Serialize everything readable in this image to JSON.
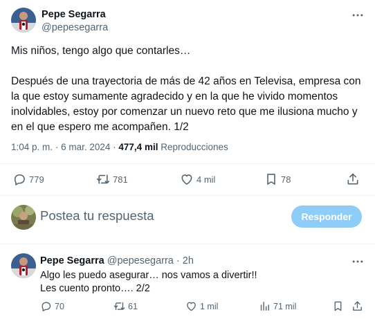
{
  "main_tweet": {
    "author_name": "Pepe Segarra",
    "author_handle": "@pepesegarra",
    "paragraphs": [
      "Mis niños, tengo algo que contarles…",
      "Después de una trayectoria de más de 42 años en Televisa, empresa con la que estoy sumamente agradecido y en la que he vivido momentos inolvidables, estoy por comenzar un nuevo reto que me ilusiona mucho y en el que espero me acompañen. 1/2"
    ],
    "time": "1:04 p. m.",
    "separator": "·",
    "date": "6 mar. 2024",
    "views_count": "477,4 mil",
    "views_label": "Reproducciones",
    "replies": "779",
    "reposts": "781",
    "likes": "4 mil",
    "bookmarks": "78"
  },
  "reply_box": {
    "placeholder": "Postea tu respuesta",
    "button_label": "Responder"
  },
  "reply_tweet": {
    "author_name": "Pepe Segarra",
    "author_handle": "@pepesegarra",
    "separator": "·",
    "time_ago": "2h",
    "lines": [
      "Algo les puedo asegurar… nos vamos a divertir!!",
      "Les cuento pronto…. 2/2"
    ],
    "replies": "70",
    "reposts": "61",
    "likes": "1 mil",
    "views": "71 mil"
  },
  "colors": {
    "text": "#0f1419",
    "secondary": "#536471",
    "divider": "#eff3f4",
    "reply_button": "#8ecdf8"
  },
  "icons": [
    "more-icon",
    "reply-icon",
    "repost-icon",
    "like-icon",
    "bookmark-icon",
    "share-icon",
    "views-icon"
  ]
}
